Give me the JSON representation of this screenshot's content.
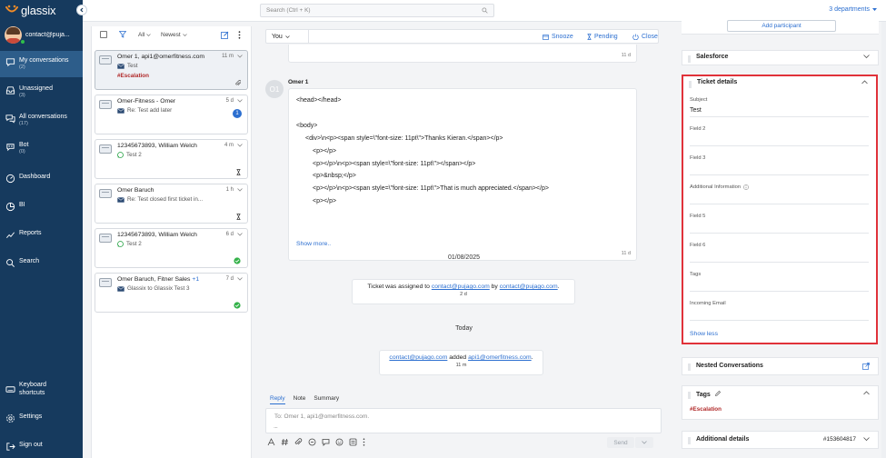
{
  "app": {
    "logo_text": "glassix"
  },
  "user": {
    "email": "contact@puja..."
  },
  "search": {
    "placeholder": "Search (Ctrl + K)"
  },
  "departments": {
    "label": "3 departments"
  },
  "nav": [
    {
      "label": "My conversations",
      "count": "(2)"
    },
    {
      "label": "Unassigned",
      "count": "(3)"
    },
    {
      "label": "All conversations",
      "count": "(17)"
    },
    {
      "label": "Bot",
      "count": "(0)"
    },
    {
      "label": "Dashboard"
    },
    {
      "label": "BI"
    },
    {
      "label": "Reports"
    },
    {
      "label": "Search"
    }
  ],
  "nav_bottom": [
    {
      "label_line1": "Keyboard",
      "label_line2": "shortcuts"
    },
    {
      "label": "Settings"
    },
    {
      "label": "Sign out"
    }
  ],
  "list_toolbar": {
    "filter_value": "All",
    "sort_value": "Newest"
  },
  "conversations": [
    {
      "name": "Omer 1, api1@omerfitness.com",
      "time": "11 m",
      "subject": "Test",
      "tag": "#Escalation"
    },
    {
      "name": "Omer-Fitness - Omer",
      "time": "5 d",
      "subject": "Re: Test add later",
      "badge": "1"
    },
    {
      "name": "12345673893, William Welch",
      "time": "4 m",
      "subject": "Test 2"
    },
    {
      "name": "Omer Baruch",
      "time": "1 h",
      "subject": "Re: Test closed first ticket in..."
    },
    {
      "name": "12345673893, William Welch",
      "time": "6 d",
      "subject": "Test 2"
    },
    {
      "name": "Omer Baruch, Fitner Sales",
      "extra": "+1",
      "time": "7 d",
      "subject": "Glassix to Glassix Test 3"
    }
  ],
  "chat_toolbar": {
    "sender": "You",
    "snooze": "Snooze",
    "pending": "Pending",
    "close": "Close"
  },
  "messages": {
    "top_time": "11 d",
    "sender_initials": "O1",
    "sender_name": "Omer 1",
    "html_lines": [
      "<head></head>",
      "",
      "<body>",
      "<div>\\n<p><span style=\\\"font-size: 11pt\\\">Thanks Kieran.</span></p>",
      "<p></p>",
      "<p></p>\\n<p><span style=\\\"font-size: 11pt\\\"></span></p>",
      "<p>&nbsp;</p>",
      "<p></p>\\n<p><span style=\\\"font-size: 11pt\\\">That is much appreciated.</span></p>",
      "<p></p>"
    ],
    "show_more": "Show more..",
    "body_time": "11 d",
    "date_sep": "01/08/2025",
    "sys1": {
      "prefix": "Ticket was assigned to ",
      "link1": "contact@pujago.com",
      "mid": " by ",
      "link2": "contact@pujago.com",
      "suffix": ".",
      "time": "2 d"
    },
    "today_sep": "Today",
    "sys2": {
      "link1": "contact@pujago.com",
      "mid": " added ",
      "link2": "api1@omerfitness.com",
      "suffix": ".",
      "time": "11 m"
    }
  },
  "composer": {
    "tabs": [
      "Reply",
      "Note",
      "Summary"
    ],
    "to_placeholder": "To: Omer 1, api1@omerfitness.com.",
    "dots": "...",
    "send": "Send"
  },
  "right_panel": {
    "add_participant": "Add participant",
    "salesforce": "Salesforce",
    "ticket_details": {
      "title": "Ticket details",
      "fields": [
        {
          "label": "Subject",
          "value": "Test"
        },
        {
          "label": "Field 2",
          "value": ""
        },
        {
          "label": "Field 3",
          "value": ""
        },
        {
          "label": "Additional Information",
          "value": ""
        },
        {
          "label": "Field 5",
          "value": ""
        },
        {
          "label": "Field 6",
          "value": ""
        },
        {
          "label": "Tags",
          "value": ""
        },
        {
          "label": "Incoming Email",
          "value": ""
        }
      ],
      "show_less": "Show less"
    },
    "nested": "Nested Conversations",
    "tags": {
      "title": "Tags",
      "value": "#Escalation"
    },
    "additional": {
      "title": "Additional details",
      "id": "#153604817"
    }
  },
  "colors": {
    "sidebar": "#163a5e",
    "accent": "#2c6fd0",
    "highlight": "#e0323a",
    "tag": "#b12a2a"
  }
}
